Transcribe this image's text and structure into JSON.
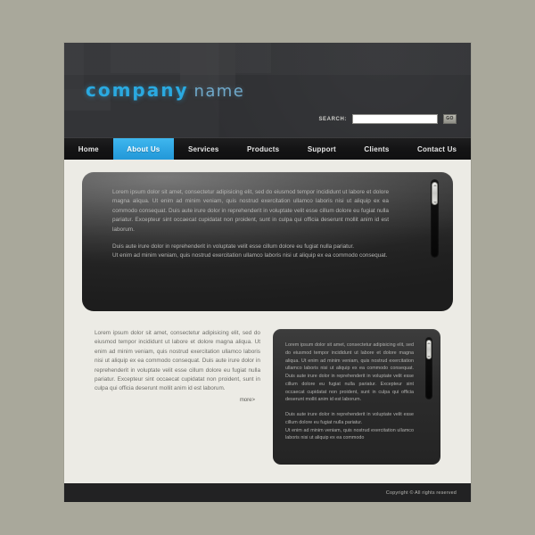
{
  "site": {
    "background_color": "#a9a89b",
    "page_background": "#ecebe5",
    "accent_color": "#2ea5e2",
    "header_color": "#2f3033"
  },
  "header": {
    "logo_primary": "company",
    "logo_secondary": "name",
    "search": {
      "label": "SEARCH:",
      "value": "",
      "placeholder": "",
      "button_label": "GO"
    }
  },
  "nav": {
    "items": [
      {
        "label": "Home",
        "active": false
      },
      {
        "label": "About Us",
        "active": true
      },
      {
        "label": "Services",
        "active": false
      },
      {
        "label": "Products",
        "active": false
      },
      {
        "label": "Support",
        "active": false
      },
      {
        "label": "Clients",
        "active": false
      },
      {
        "label": "Contact Us",
        "active": false
      }
    ]
  },
  "hero": {
    "paragraph_1": "Lorem ipsum dolor sit amet, consectetur adipisicing elit, sed do eiusmod tempor incididunt ut labore et dolore magna aliqua. Ut enim ad minim veniam, quis nostrud exercitation ullamco laboris nisi ut aliquip ex ea commodo consequat. Duis aute irure dolor in reprehenderit in voluptate velit esse cillum dolore eu fugiat nulla pariatur. Excepteur sint occaecat cupidatat non proident, sunt in culpa qui officia deserunt mollit anim id est laborum.",
    "paragraph_2": "Duis aute irure dolor in reprehenderit in voluptate velit esse cillum dolore eu fugiat nulla pariatur.",
    "paragraph_3": "Ut enim ad minim veniam, quis nostrud exercitation ullamco laboris nisi ut aliquip ex ea commodo consequat.",
    "scrollbar": {
      "name": "vertical-scrollbar"
    }
  },
  "lower": {
    "left_column": {
      "text": "Lorem ipsum dolor sit amet, consectetur adipisicing elit, sed do eiusmod tempor incididunt ut labore et dolore magna aliqua. Ut enim ad minim veniam, quis nostrud exercitation ullamco laboris nisi ut aliquip ex ea commodo consequat. Duis aute irure dolor in reprehenderit in voluptate velit esse cillum dolore eu fugiat nulla pariatur. Excepteur sint occaecat cupidatat non proident, sunt in culpa qui officia deserunt mollit anim id est laborum.",
      "more_label": "more>"
    },
    "right_card": {
      "paragraph_1": "Lorem ipsum dolor sit amet, consectetur adipisicing elit, sed do eiusmod tempor incididunt ut labore et dolore magna aliqua. Ut enim ad minim veniam, quis nostrud exercitation ullamco laboris nisi ut aliquip ex ea commodo consequat. Duis aute irure dolor in reprehenderit in voluptate velit esse cillum dolore eu fugiat nulla pariatur. Excepteur sint occaecat cupidatat non proident, sunt in culpa qui officia deserunt mollit anim id est laborum.",
      "paragraph_2": "Duis aute irure dolor in reprehenderit in voluptate velit esse cillum dolore eu fugiat nulla pariatur.",
      "paragraph_3": "Ut enim ad minim veniam, quis nostrud exercitation ullamco laboris nisi ut aliquip ex ea commodo"
    }
  },
  "footer": {
    "copyright": "Copyright © All rights reserved"
  }
}
